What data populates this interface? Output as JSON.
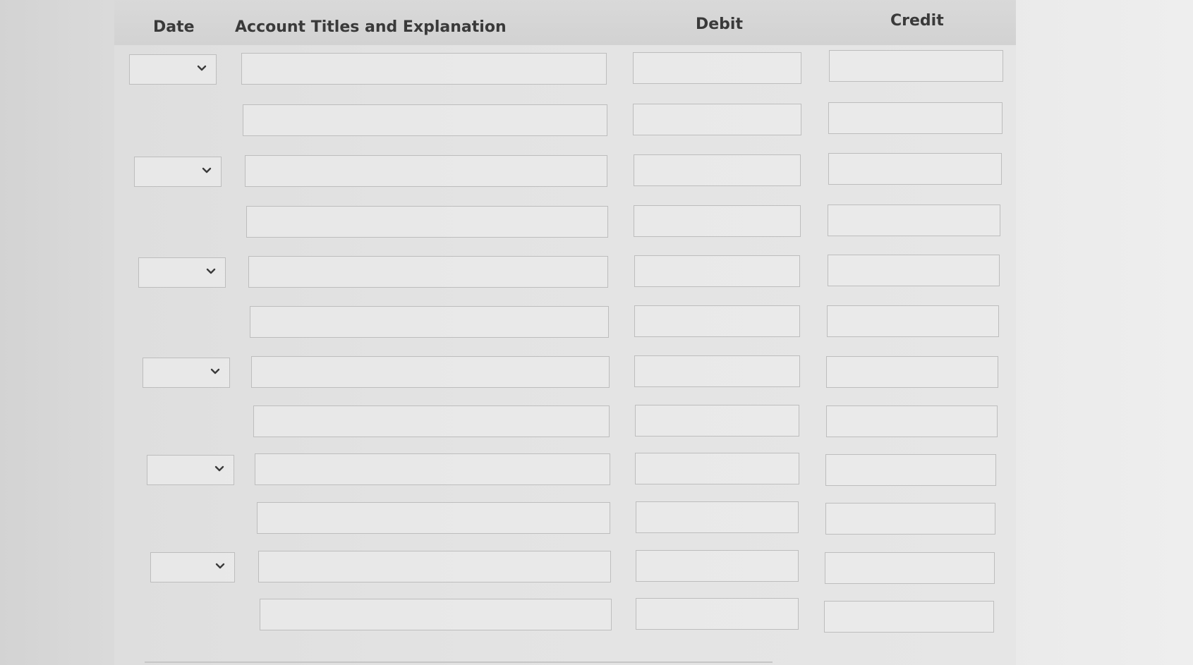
{
  "header": {
    "date_label": "Date",
    "account_label": "Account Titles and Explanation",
    "debit_label": "Debit",
    "credit_label": "Credit"
  },
  "entries": [
    {
      "date_selected": "",
      "lines": [
        {
          "account": "",
          "debit": "",
          "credit": ""
        },
        {
          "account": "",
          "debit": "",
          "credit": ""
        }
      ]
    },
    {
      "date_selected": "",
      "lines": [
        {
          "account": "",
          "debit": "",
          "credit": ""
        },
        {
          "account": "",
          "debit": "",
          "credit": ""
        }
      ]
    },
    {
      "date_selected": "",
      "lines": [
        {
          "account": "",
          "debit": "",
          "credit": ""
        },
        {
          "account": "",
          "debit": "",
          "credit": ""
        }
      ]
    },
    {
      "date_selected": "",
      "lines": [
        {
          "account": "",
          "debit": "",
          "credit": ""
        },
        {
          "account": "",
          "debit": "",
          "credit": ""
        }
      ]
    },
    {
      "date_selected": "",
      "lines": [
        {
          "account": "",
          "debit": "",
          "credit": ""
        },
        {
          "account": "",
          "debit": "",
          "credit": ""
        }
      ]
    },
    {
      "date_selected": "",
      "lines": [
        {
          "account": "",
          "debit": "",
          "credit": ""
        },
        {
          "account": "",
          "debit": "",
          "credit": ""
        }
      ]
    }
  ],
  "icons": {
    "date_dropdown": "chevron-down-icon"
  }
}
